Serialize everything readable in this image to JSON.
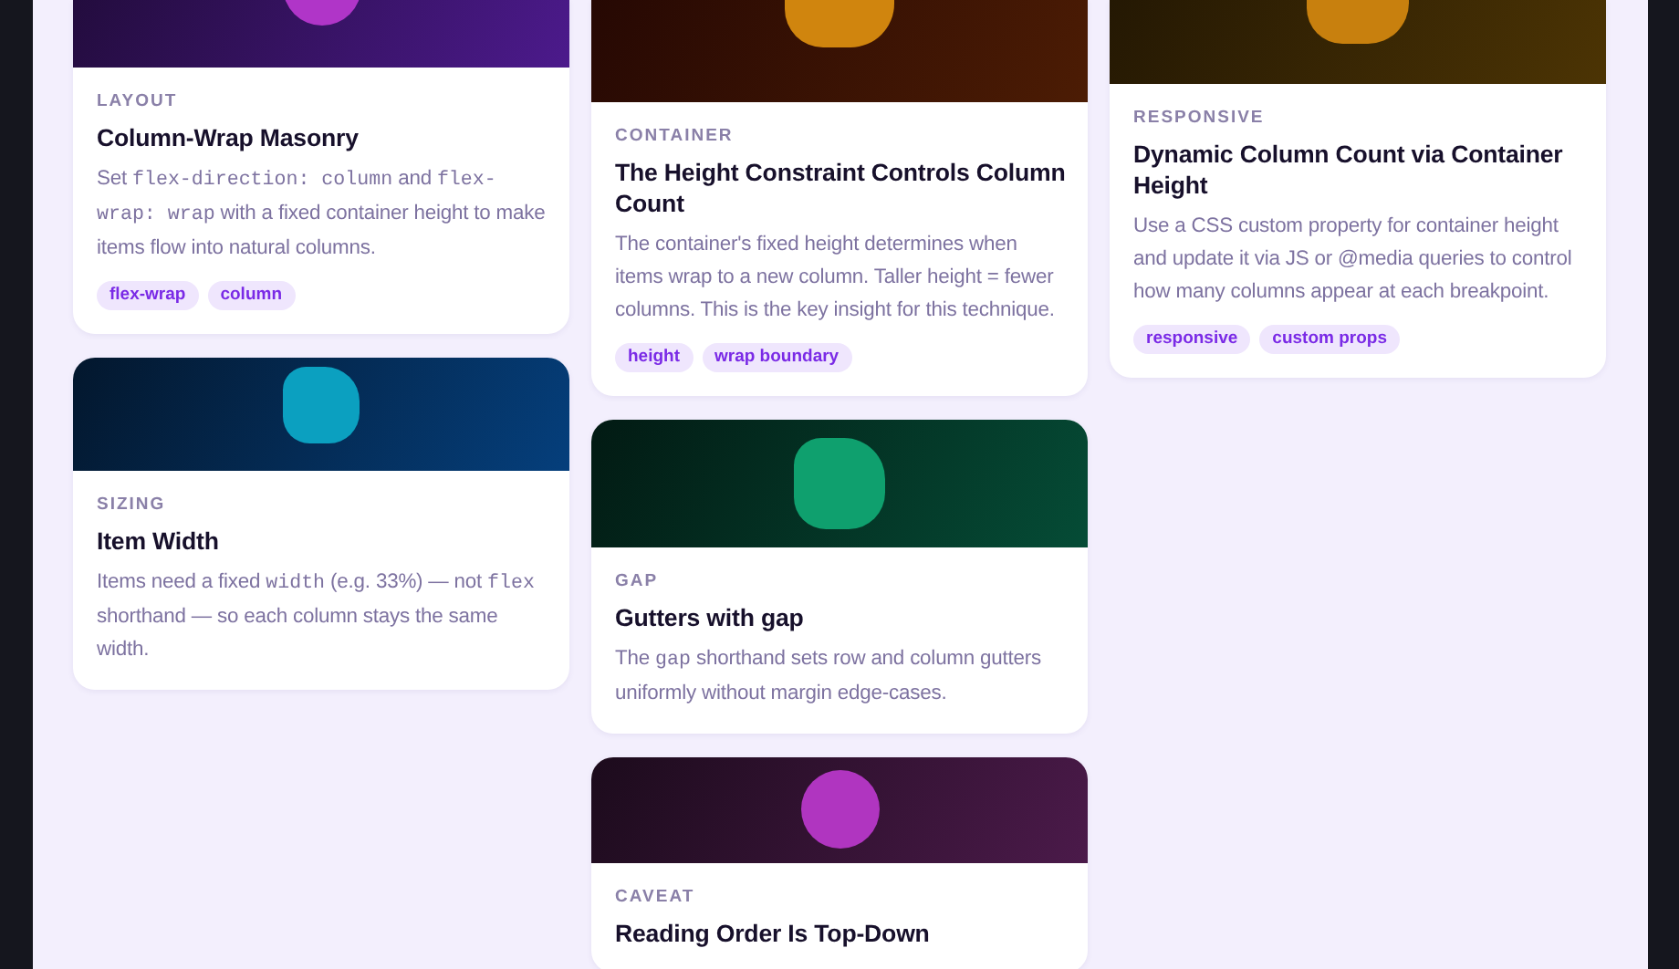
{
  "columns": [
    {
      "cards": [
        {
          "media": {
            "kind": "circle",
            "color": "#b035c8"
          },
          "category": "LAYOUT",
          "title": "Column-Wrap Masonry",
          "body": [
            {
              "kind": "text",
              "text": "Set "
            },
            {
              "kind": "code",
              "text": "flex-direction: column"
            },
            {
              "kind": "text",
              "text": " and "
            },
            {
              "kind": "code",
              "text": "flex-wrap: wrap"
            },
            {
              "kind": "text",
              "text": " with a fixed container height to make items flow into natural columns."
            }
          ],
          "tags": [
            "flex-wrap",
            "column"
          ]
        },
        {
          "media": {
            "kind": "blob",
            "color": "#0ba0c0"
          },
          "category": "SIZING",
          "title": "Item Width",
          "body": [
            {
              "kind": "text",
              "text": "Items need a fixed "
            },
            {
              "kind": "code",
              "text": "width"
            },
            {
              "kind": "text",
              "text": " (e.g. 33%) — not "
            },
            {
              "kind": "code",
              "text": "flex"
            },
            {
              "kind": "text",
              "text": " shorthand — so each column stays the same width."
            }
          ]
        }
      ]
    },
    {
      "cards": [
        {
          "media": {
            "kind": "blob",
            "color": "#d0850e"
          },
          "category": "CONTAINER",
          "title": "The Height Constraint Controls Column Count",
          "body": [
            {
              "kind": "text",
              "text": "The container's fixed height determines when items wrap to a new column. Taller height = fewer columns. This is the key insight for this technique."
            }
          ],
          "tags": [
            "height",
            "wrap boundary"
          ]
        },
        {
          "media": {
            "kind": "blob",
            "color": "#0fa06e"
          },
          "category": "GAP",
          "title": "Gutters with gap",
          "body": [
            {
              "kind": "text",
              "text": "The "
            },
            {
              "kind": "code",
              "text": "gap"
            },
            {
              "kind": "text",
              "text": " shorthand sets row and column gutters uniformly without margin edge-cases."
            }
          ]
        },
        {
          "media": {
            "kind": "circle",
            "color": "#b035c0"
          },
          "category": "CAVEAT",
          "title": "Reading Order Is Top-Down"
        }
      ]
    },
    {
      "cards": [
        {
          "media": {
            "kind": "blob",
            "color": "#c8800e"
          },
          "category": "RESPONSIVE",
          "title": "Dynamic Column Count via Container Height",
          "body": [
            {
              "kind": "text",
              "text": "Use a CSS custom property for container height and update it via JS or @media queries to control how many columns appear at each breakpoint."
            }
          ],
          "tags": [
            "responsive",
            "custom props"
          ]
        }
      ]
    }
  ]
}
